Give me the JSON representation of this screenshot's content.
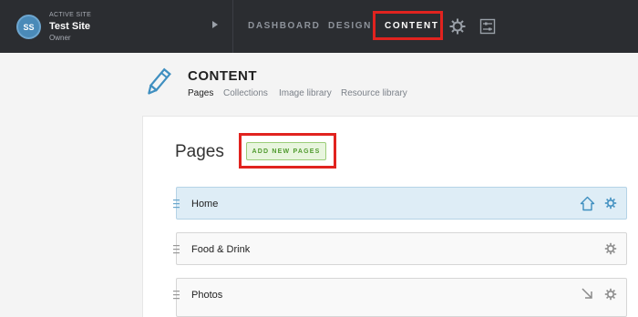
{
  "site": {
    "label": "ACTIVE SITE",
    "name": "Test Site",
    "role": "Owner",
    "avatar_initials": "SS"
  },
  "nav": {
    "dashboard": "DASHBOARD",
    "design": "DESIGN",
    "content": "CONTENT",
    "active": "content",
    "icons": [
      "gear-icon",
      "sliders-icon"
    ]
  },
  "header": {
    "title": "CONTENT",
    "icon": "pencil-icon",
    "subnav": [
      "Pages",
      "Collections",
      "Image library",
      "Resource library"
    ],
    "active_subnav": "Pages"
  },
  "pages": {
    "heading": "Pages",
    "add_button": "ADD NEW PAGES",
    "rows": [
      {
        "label": "Home",
        "icons": [
          "home-icon",
          "gear-icon"
        ],
        "selected": true
      },
      {
        "label": "Food & Drink",
        "icons": [
          "gear-icon"
        ],
        "selected": false
      },
      {
        "label": "Photos",
        "icons": [
          "arrow-down-right-icon",
          "gear-icon"
        ],
        "selected": false
      }
    ]
  },
  "colors": {
    "topbar": "#2b2d31",
    "highlight": "#e1231f",
    "accent_green": "#4f9a2d",
    "selected_row": "#deedf6",
    "icon_blue": "#3f8fc0"
  }
}
